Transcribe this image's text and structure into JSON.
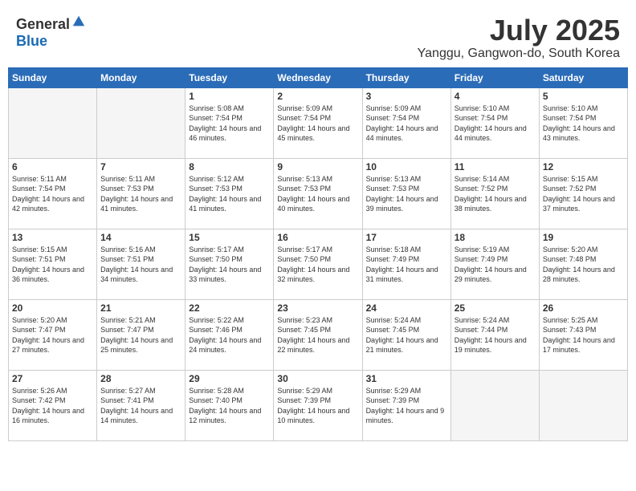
{
  "logo": {
    "general": "General",
    "blue": "Blue"
  },
  "title": "July 2025",
  "location": "Yanggu, Gangwon-do, South Korea",
  "headers": [
    "Sunday",
    "Monday",
    "Tuesday",
    "Wednesday",
    "Thursday",
    "Friday",
    "Saturday"
  ],
  "weeks": [
    [
      {
        "day": "",
        "info": ""
      },
      {
        "day": "",
        "info": ""
      },
      {
        "day": "1",
        "info": "Sunrise: 5:08 AM\nSunset: 7:54 PM\nDaylight: 14 hours and 46 minutes."
      },
      {
        "day": "2",
        "info": "Sunrise: 5:09 AM\nSunset: 7:54 PM\nDaylight: 14 hours and 45 minutes."
      },
      {
        "day": "3",
        "info": "Sunrise: 5:09 AM\nSunset: 7:54 PM\nDaylight: 14 hours and 44 minutes."
      },
      {
        "day": "4",
        "info": "Sunrise: 5:10 AM\nSunset: 7:54 PM\nDaylight: 14 hours and 44 minutes."
      },
      {
        "day": "5",
        "info": "Sunrise: 5:10 AM\nSunset: 7:54 PM\nDaylight: 14 hours and 43 minutes."
      }
    ],
    [
      {
        "day": "6",
        "info": "Sunrise: 5:11 AM\nSunset: 7:54 PM\nDaylight: 14 hours and 42 minutes."
      },
      {
        "day": "7",
        "info": "Sunrise: 5:11 AM\nSunset: 7:53 PM\nDaylight: 14 hours and 41 minutes."
      },
      {
        "day": "8",
        "info": "Sunrise: 5:12 AM\nSunset: 7:53 PM\nDaylight: 14 hours and 41 minutes."
      },
      {
        "day": "9",
        "info": "Sunrise: 5:13 AM\nSunset: 7:53 PM\nDaylight: 14 hours and 40 minutes."
      },
      {
        "day": "10",
        "info": "Sunrise: 5:13 AM\nSunset: 7:53 PM\nDaylight: 14 hours and 39 minutes."
      },
      {
        "day": "11",
        "info": "Sunrise: 5:14 AM\nSunset: 7:52 PM\nDaylight: 14 hours and 38 minutes."
      },
      {
        "day": "12",
        "info": "Sunrise: 5:15 AM\nSunset: 7:52 PM\nDaylight: 14 hours and 37 minutes."
      }
    ],
    [
      {
        "day": "13",
        "info": "Sunrise: 5:15 AM\nSunset: 7:51 PM\nDaylight: 14 hours and 36 minutes."
      },
      {
        "day": "14",
        "info": "Sunrise: 5:16 AM\nSunset: 7:51 PM\nDaylight: 14 hours and 34 minutes."
      },
      {
        "day": "15",
        "info": "Sunrise: 5:17 AM\nSunset: 7:50 PM\nDaylight: 14 hours and 33 minutes."
      },
      {
        "day": "16",
        "info": "Sunrise: 5:17 AM\nSunset: 7:50 PM\nDaylight: 14 hours and 32 minutes."
      },
      {
        "day": "17",
        "info": "Sunrise: 5:18 AM\nSunset: 7:49 PM\nDaylight: 14 hours and 31 minutes."
      },
      {
        "day": "18",
        "info": "Sunrise: 5:19 AM\nSunset: 7:49 PM\nDaylight: 14 hours and 29 minutes."
      },
      {
        "day": "19",
        "info": "Sunrise: 5:20 AM\nSunset: 7:48 PM\nDaylight: 14 hours and 28 minutes."
      }
    ],
    [
      {
        "day": "20",
        "info": "Sunrise: 5:20 AM\nSunset: 7:47 PM\nDaylight: 14 hours and 27 minutes."
      },
      {
        "day": "21",
        "info": "Sunrise: 5:21 AM\nSunset: 7:47 PM\nDaylight: 14 hours and 25 minutes."
      },
      {
        "day": "22",
        "info": "Sunrise: 5:22 AM\nSunset: 7:46 PM\nDaylight: 14 hours and 24 minutes."
      },
      {
        "day": "23",
        "info": "Sunrise: 5:23 AM\nSunset: 7:45 PM\nDaylight: 14 hours and 22 minutes."
      },
      {
        "day": "24",
        "info": "Sunrise: 5:24 AM\nSunset: 7:45 PM\nDaylight: 14 hours and 21 minutes."
      },
      {
        "day": "25",
        "info": "Sunrise: 5:24 AM\nSunset: 7:44 PM\nDaylight: 14 hours and 19 minutes."
      },
      {
        "day": "26",
        "info": "Sunrise: 5:25 AM\nSunset: 7:43 PM\nDaylight: 14 hours and 17 minutes."
      }
    ],
    [
      {
        "day": "27",
        "info": "Sunrise: 5:26 AM\nSunset: 7:42 PM\nDaylight: 14 hours and 16 minutes."
      },
      {
        "day": "28",
        "info": "Sunrise: 5:27 AM\nSunset: 7:41 PM\nDaylight: 14 hours and 14 minutes."
      },
      {
        "day": "29",
        "info": "Sunrise: 5:28 AM\nSunset: 7:40 PM\nDaylight: 14 hours and 12 minutes."
      },
      {
        "day": "30",
        "info": "Sunrise: 5:29 AM\nSunset: 7:39 PM\nDaylight: 14 hours and 10 minutes."
      },
      {
        "day": "31",
        "info": "Sunrise: 5:29 AM\nSunset: 7:39 PM\nDaylight: 14 hours and 9 minutes."
      },
      {
        "day": "",
        "info": ""
      },
      {
        "day": "",
        "info": ""
      }
    ]
  ]
}
